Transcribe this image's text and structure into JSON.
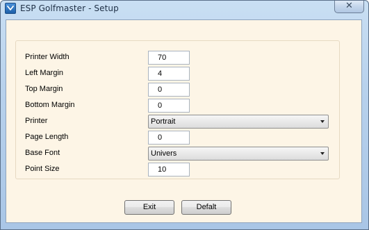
{
  "window": {
    "title": "ESP Golfmaster - Setup",
    "close_glyph": "✕",
    "icon": "golfmaster-app-icon"
  },
  "colors": {
    "client_background": "#fdf5e6",
    "titlebar": "#b7d1ec"
  },
  "form": {
    "printer_width": {
      "label": "Printer Width",
      "value": "70"
    },
    "left_margin": {
      "label": "Left Margin",
      "value": "4"
    },
    "top_margin": {
      "label": "Top Margin",
      "value": "0"
    },
    "bottom_margin": {
      "label": "Bottom Margin",
      "value": "0"
    },
    "printer": {
      "label": "Printer",
      "selected": "Portrait"
    },
    "page_length": {
      "label": "Page Length",
      "value": "0"
    },
    "base_font": {
      "label": "Base Font",
      "selected": "Univers"
    },
    "point_size": {
      "label": "Point Size",
      "value": "10"
    }
  },
  "buttons": {
    "exit": "Exit",
    "default": "Defalt"
  }
}
